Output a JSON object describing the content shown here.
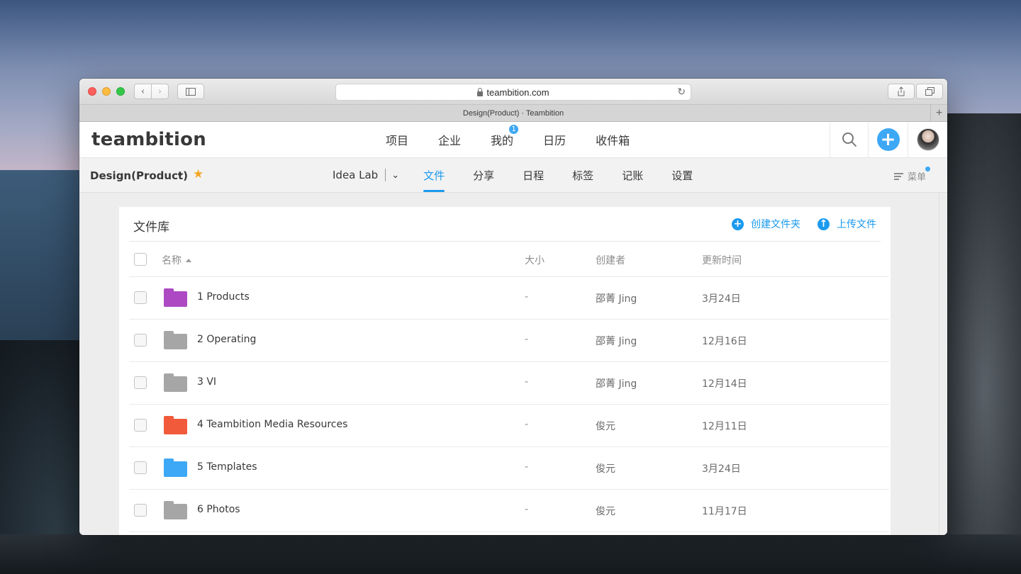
{
  "browser": {
    "url": "teambition.com",
    "page_title": "Design(Product) · Teambition"
  },
  "app": {
    "logo": "teambition",
    "top_nav": [
      {
        "label": "项目"
      },
      {
        "label": "企业"
      },
      {
        "label": "我的",
        "badge": "1"
      },
      {
        "label": "日历"
      },
      {
        "label": "收件箱"
      }
    ],
    "accent_color": "#1b9aee"
  },
  "project": {
    "name": "Design(Product)",
    "starred": true,
    "org": "Idea Lab",
    "tabs": [
      {
        "label": "文件",
        "active": true
      },
      {
        "label": "分享"
      },
      {
        "label": "日程"
      },
      {
        "label": "标签"
      },
      {
        "label": "记账"
      },
      {
        "label": "设置"
      }
    ],
    "menu_label": "菜单"
  },
  "library": {
    "title": "文件库",
    "create_folder": "创建文件夹",
    "upload_file": "上传文件",
    "columns": {
      "name": "名称",
      "size": "大小",
      "creator": "创建者",
      "updated": "更新时间"
    },
    "rows": [
      {
        "name": "1 Products",
        "size": "-",
        "creator": "邵菁 Jing",
        "updated": "3月24日",
        "folder_color": "#ad49c2"
      },
      {
        "name": "2 Operating",
        "size": "-",
        "creator": "邵菁 Jing",
        "updated": "12月16日",
        "folder_color": "#a6a6a6"
      },
      {
        "name": "3 VI",
        "size": "-",
        "creator": "邵菁 Jing",
        "updated": "12月14日",
        "folder_color": "#a6a6a6"
      },
      {
        "name": "4 Teambition Media Resources",
        "size": "-",
        "creator": "俊元",
        "updated": "12月11日",
        "folder_color": "#f15a3a"
      },
      {
        "name": "5 Templates",
        "size": "-",
        "creator": "俊元",
        "updated": "3月24日",
        "folder_color": "#3da8f5"
      },
      {
        "name": "6 Photos",
        "size": "-",
        "creator": "俊元",
        "updated": "11月17日",
        "folder_color": "#a6a6a6"
      }
    ]
  }
}
